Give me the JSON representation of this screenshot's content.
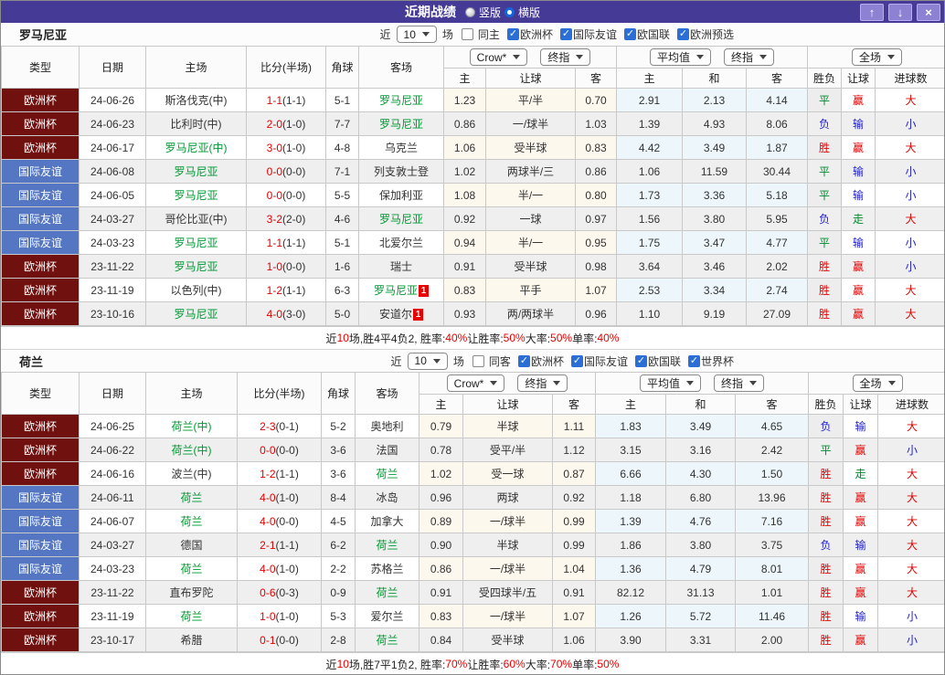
{
  "titlebar": {
    "title": "近期战绩",
    "layout_options": [
      {
        "label": "竖版",
        "selected": false
      },
      {
        "label": "横版",
        "selected": true
      }
    ],
    "buttons": {
      "up": "↑",
      "down": "↓",
      "close": "×"
    }
  },
  "filter_labels": {
    "near": "近",
    "games": "场"
  },
  "header": {
    "cols": [
      "类型",
      "日期",
      "主场",
      "比分(半场)",
      "角球",
      "客场"
    ],
    "selects": {
      "g1a": "Crow*",
      "g1b": "终指",
      "g2a": "平均值",
      "g2b": "终指",
      "g3": "全场"
    },
    "sub": [
      "主",
      "让球",
      "客",
      "主",
      "和",
      "客",
      "胜负",
      "让球",
      "进球数"
    ]
  },
  "league_colors": {
    "欧洲杯": "#70100f",
    "国际友谊": "#5577c3"
  },
  "result_colors": {
    "胜": "#e60000",
    "平": "#008a2e",
    "负": "#1f1fd0",
    "赢": "#e60000",
    "走": "#008a2e",
    "输": "#1f1fd0",
    "大": "#e60000",
    "小": "#1f1fd0"
  },
  "sections": [
    {
      "team": "罗马尼亚",
      "filter": {
        "games": "10",
        "same_label": "同主",
        "same_checked": false,
        "leagues": [
          {
            "label": "欧洲杯",
            "checked": true
          },
          {
            "label": "国际友谊",
            "checked": true
          },
          {
            "label": "欧国联",
            "checked": true
          },
          {
            "label": "欧洲预选",
            "checked": true
          }
        ]
      },
      "rows": [
        {
          "type": "欧洲杯",
          "date": "24-06-26",
          "home": "斯洛伐克(中)",
          "home_self": false,
          "score": "1-1",
          "half": "(1-1)",
          "corner": "5-1",
          "away": "罗马尼亚",
          "away_self": true,
          "away_badge": "",
          "o1": "1.23",
          "line": "平/半",
          "o2": "0.70",
          "m1": "2.91",
          "m2": "2.13",
          "m3": "4.14",
          "r1": "平",
          "r2": "赢",
          "r3": "大"
        },
        {
          "type": "欧洲杯",
          "date": "24-06-23",
          "home": "比利时(中)",
          "home_self": false,
          "score": "2-0",
          "half": "(1-0)",
          "corner": "7-7",
          "away": "罗马尼亚",
          "away_self": true,
          "away_badge": "",
          "o1": "0.86",
          "line": "一/球半",
          "o2": "1.03",
          "m1": "1.39",
          "m2": "4.93",
          "m3": "8.06",
          "r1": "负",
          "r2": "输",
          "r3": "小"
        },
        {
          "type": "欧洲杯",
          "date": "24-06-17",
          "home": "罗马尼亚(中)",
          "home_self": true,
          "score": "3-0",
          "half": "(1-0)",
          "corner": "4-8",
          "away": "乌克兰",
          "away_self": false,
          "away_badge": "",
          "o1": "1.06",
          "line": "受半球",
          "o2": "0.83",
          "m1": "4.42",
          "m2": "3.49",
          "m3": "1.87",
          "r1": "胜",
          "r2": "赢",
          "r3": "大"
        },
        {
          "type": "国际友谊",
          "date": "24-06-08",
          "home": "罗马尼亚",
          "home_self": true,
          "score": "0-0",
          "half": "(0-0)",
          "corner": "7-1",
          "away": "列支敦士登",
          "away_self": false,
          "away_badge": "",
          "o1": "1.02",
          "line": "两球半/三",
          "o2": "0.86",
          "m1": "1.06",
          "m2": "11.59",
          "m3": "30.44",
          "r1": "平",
          "r2": "输",
          "r3": "小"
        },
        {
          "type": "国际友谊",
          "date": "24-06-05",
          "home": "罗马尼亚",
          "home_self": true,
          "score": "0-0",
          "half": "(0-0)",
          "corner": "5-5",
          "away": "保加利亚",
          "away_self": false,
          "away_badge": "",
          "o1": "1.08",
          "line": "半/一",
          "o2": "0.80",
          "m1": "1.73",
          "m2": "3.36",
          "m3": "5.18",
          "r1": "平",
          "r2": "输",
          "r3": "小"
        },
        {
          "type": "国际友谊",
          "date": "24-03-27",
          "home": "哥伦比亚(中)",
          "home_self": false,
          "score": "3-2",
          "half": "(2-0)",
          "corner": "4-6",
          "away": "罗马尼亚",
          "away_self": true,
          "away_badge": "",
          "o1": "0.92",
          "line": "一球",
          "o2": "0.97",
          "m1": "1.56",
          "m2": "3.80",
          "m3": "5.95",
          "r1": "负",
          "r2": "走",
          "r3": "大"
        },
        {
          "type": "国际友谊",
          "date": "24-03-23",
          "home": "罗马尼亚",
          "home_self": true,
          "score": "1-1",
          "half": "(1-1)",
          "corner": "5-1",
          "away": "北爱尔兰",
          "away_self": false,
          "away_badge": "",
          "o1": "0.94",
          "line": "半/一",
          "o2": "0.95",
          "m1": "1.75",
          "m2": "3.47",
          "m3": "4.77",
          "r1": "平",
          "r2": "输",
          "r3": "小"
        },
        {
          "type": "欧洲杯",
          "date": "23-11-22",
          "home": "罗马尼亚",
          "home_self": true,
          "score": "1-0",
          "half": "(0-0)",
          "corner": "1-6",
          "away": "瑞士",
          "away_self": false,
          "away_badge": "",
          "o1": "0.91",
          "line": "受半球",
          "o2": "0.98",
          "m1": "3.64",
          "m2": "3.46",
          "m3": "2.02",
          "r1": "胜",
          "r2": "赢",
          "r3": "小"
        },
        {
          "type": "欧洲杯",
          "date": "23-11-19",
          "home": "以色列(中)",
          "home_self": false,
          "score": "1-2",
          "half": "(1-1)",
          "corner": "6-3",
          "away": "罗马尼亚",
          "away_self": true,
          "away_badge": "1",
          "o1": "0.83",
          "line": "平手",
          "o2": "1.07",
          "m1": "2.53",
          "m2": "3.34",
          "m3": "2.74",
          "r1": "胜",
          "r2": "赢",
          "r3": "大"
        },
        {
          "type": "欧洲杯",
          "date": "23-10-16",
          "home": "罗马尼亚",
          "home_self": true,
          "score": "4-0",
          "half": "(3-0)",
          "corner": "5-0",
          "away": "安道尔",
          "away_self": false,
          "away_badge": "1",
          "o1": "0.93",
          "line": "两/两球半",
          "o2": "0.96",
          "m1": "1.10",
          "m2": "9.19",
          "m3": "27.09",
          "r1": "胜",
          "r2": "赢",
          "r3": "大"
        }
      ],
      "summary": [
        {
          "t": "近"
        },
        {
          "t": "10",
          "red": true
        },
        {
          "t": "场,胜4平4负2, 胜率:"
        },
        {
          "t": "40%",
          "red": true
        },
        {
          "t": " 让胜率:"
        },
        {
          "t": "50%",
          "red": true
        },
        {
          "t": " 大率:"
        },
        {
          "t": "50%",
          "red": true
        },
        {
          "t": " 单率:"
        },
        {
          "t": "40%",
          "red": true
        }
      ]
    },
    {
      "team": "荷兰",
      "filter": {
        "games": "10",
        "same_label": "同客",
        "same_checked": false,
        "leagues": [
          {
            "label": "欧洲杯",
            "checked": true
          },
          {
            "label": "国际友谊",
            "checked": true
          },
          {
            "label": "欧国联",
            "checked": true
          },
          {
            "label": "世界杯",
            "checked": true
          }
        ]
      },
      "rows": [
        {
          "type": "欧洲杯",
          "date": "24-06-25",
          "home": "荷兰(中)",
          "home_self": true,
          "score": "2-3",
          "half": "(0-1)",
          "corner": "5-2",
          "away": "奥地利",
          "away_self": false,
          "away_badge": "",
          "o1": "0.79",
          "line": "半球",
          "o2": "1.11",
          "m1": "1.83",
          "m2": "3.49",
          "m3": "4.65",
          "r1": "负",
          "r2": "输",
          "r3": "大"
        },
        {
          "type": "欧洲杯",
          "date": "24-06-22",
          "home": "荷兰(中)",
          "home_self": true,
          "score": "0-0",
          "half": "(0-0)",
          "corner": "3-6",
          "away": "法国",
          "away_self": false,
          "away_badge": "",
          "o1": "0.78",
          "line": "受平/半",
          "o2": "1.12",
          "m1": "3.15",
          "m2": "3.16",
          "m3": "2.42",
          "r1": "平",
          "r2": "赢",
          "r3": "小"
        },
        {
          "type": "欧洲杯",
          "date": "24-06-16",
          "home": "波兰(中)",
          "home_self": false,
          "score": "1-2",
          "half": "(1-1)",
          "corner": "3-6",
          "away": "荷兰",
          "away_self": true,
          "away_badge": "",
          "o1": "1.02",
          "line": "受一球",
          "o2": "0.87",
          "m1": "6.66",
          "m2": "4.30",
          "m3": "1.50",
          "r1": "胜",
          "r2": "走",
          "r3": "大"
        },
        {
          "type": "国际友谊",
          "date": "24-06-11",
          "home": "荷兰",
          "home_self": true,
          "score": "4-0",
          "half": "(1-0)",
          "corner": "8-4",
          "away": "冰岛",
          "away_self": false,
          "away_badge": "",
          "o1": "0.96",
          "line": "两球",
          "o2": "0.92",
          "m1": "1.18",
          "m2": "6.80",
          "m3": "13.96",
          "r1": "胜",
          "r2": "赢",
          "r3": "大"
        },
        {
          "type": "国际友谊",
          "date": "24-06-07",
          "home": "荷兰",
          "home_self": true,
          "score": "4-0",
          "half": "(0-0)",
          "corner": "4-5",
          "away": "加拿大",
          "away_self": false,
          "away_badge": "",
          "o1": "0.89",
          "line": "一/球半",
          "o2": "0.99",
          "m1": "1.39",
          "m2": "4.76",
          "m3": "7.16",
          "r1": "胜",
          "r2": "赢",
          "r3": "大"
        },
        {
          "type": "国际友谊",
          "date": "24-03-27",
          "home": "德国",
          "home_self": false,
          "score": "2-1",
          "half": "(1-1)",
          "corner": "6-2",
          "away": "荷兰",
          "away_self": true,
          "away_badge": "",
          "o1": "0.90",
          "line": "半球",
          "o2": "0.99",
          "m1": "1.86",
          "m2": "3.80",
          "m3": "3.75",
          "r1": "负",
          "r2": "输",
          "r3": "大"
        },
        {
          "type": "国际友谊",
          "date": "24-03-23",
          "home": "荷兰",
          "home_self": true,
          "score": "4-0",
          "half": "(1-0)",
          "corner": "2-2",
          "away": "苏格兰",
          "away_self": false,
          "away_badge": "",
          "o1": "0.86",
          "line": "一/球半",
          "o2": "1.04",
          "m1": "1.36",
          "m2": "4.79",
          "m3": "8.01",
          "r1": "胜",
          "r2": "赢",
          "r3": "大"
        },
        {
          "type": "欧洲杯",
          "date": "23-11-22",
          "home": "直布罗陀",
          "home_self": false,
          "score": "0-6",
          "half": "(0-3)",
          "corner": "0-9",
          "away": "荷兰",
          "away_self": true,
          "away_badge": "",
          "o1": "0.91",
          "line": "受四球半/五",
          "o2": "0.91",
          "m1": "82.12",
          "m2": "31.13",
          "m3": "1.01",
          "r1": "胜",
          "r2": "赢",
          "r3": "大"
        },
        {
          "type": "欧洲杯",
          "date": "23-11-19",
          "home": "荷兰",
          "home_self": true,
          "score": "1-0",
          "half": "(1-0)",
          "corner": "5-3",
          "away": "爱尔兰",
          "away_self": false,
          "away_badge": "",
          "o1": "0.83",
          "line": "一/球半",
          "o2": "1.07",
          "m1": "1.26",
          "m2": "5.72",
          "m3": "11.46",
          "r1": "胜",
          "r2": "输",
          "r3": "小"
        },
        {
          "type": "欧洲杯",
          "date": "23-10-17",
          "home": "希腊",
          "home_self": false,
          "score": "0-1",
          "half": "(0-0)",
          "corner": "2-8",
          "away": "荷兰",
          "away_self": true,
          "away_badge": "",
          "o1": "0.84",
          "line": "受半球",
          "o2": "1.06",
          "m1": "3.90",
          "m2": "3.31",
          "m3": "2.00",
          "r1": "胜",
          "r2": "赢",
          "r3": "小"
        }
      ],
      "summary": [
        {
          "t": "近"
        },
        {
          "t": "10",
          "red": true
        },
        {
          "t": "场,胜7平1负2, 胜率:"
        },
        {
          "t": "70%",
          "red": true
        },
        {
          "t": " 让胜率:"
        },
        {
          "t": "60%",
          "red": true
        },
        {
          "t": " 大率:"
        },
        {
          "t": "70%",
          "red": true
        },
        {
          "t": " 单率:"
        },
        {
          "t": "50%",
          "red": true
        }
      ]
    }
  ]
}
